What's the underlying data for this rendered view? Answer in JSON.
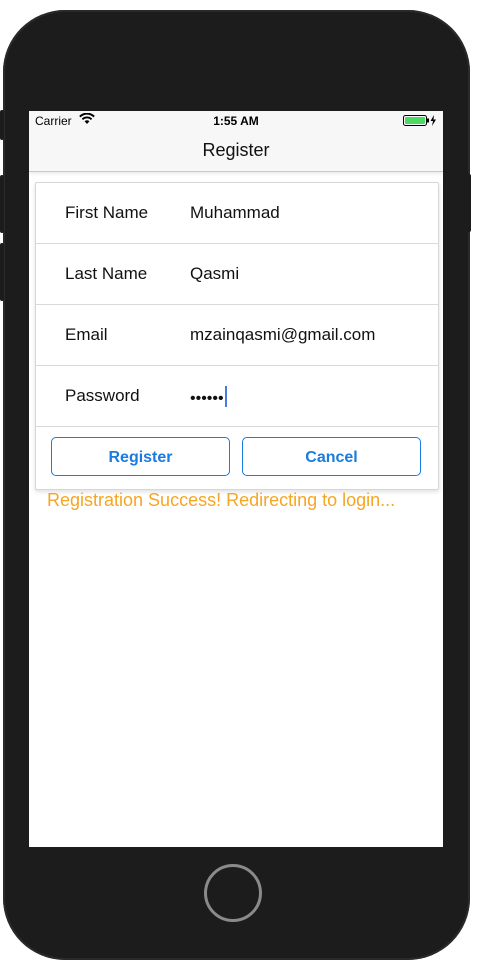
{
  "status_bar": {
    "carrier": "Carrier",
    "time": "1:55 AM",
    "wifi_icon": "wifi-icon",
    "battery_icon": "battery-charging-icon"
  },
  "nav": {
    "title": "Register"
  },
  "form": {
    "fields": [
      {
        "label": "First Name",
        "value": "Muhammad"
      },
      {
        "label": "Last Name",
        "value": "Qasmi"
      },
      {
        "label": "Email",
        "value": "mzainqasmi@gmail.com"
      },
      {
        "label": "Password",
        "value": "••••••"
      }
    ],
    "register_label": "Register",
    "cancel_label": "Cancel"
  },
  "message": "Registration Success! Redirecting to login...",
  "colors": {
    "accent": "#1a7be0",
    "success": "#f5a623",
    "device": "#1c1c1c",
    "battery": "#4cd964"
  }
}
